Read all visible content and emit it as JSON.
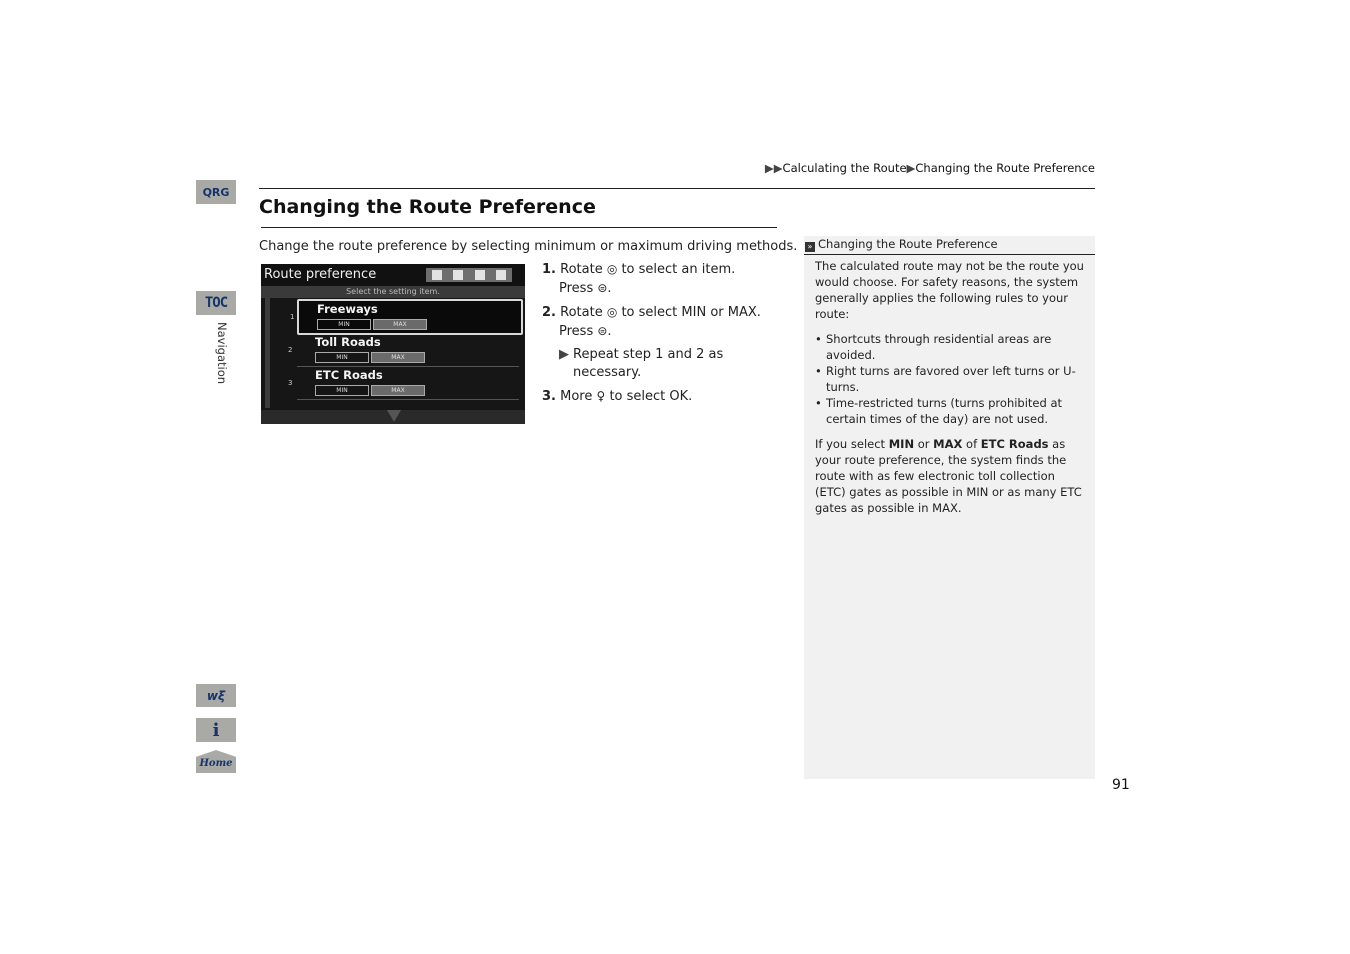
{
  "breadcrumb": {
    "prefix": "▶▶",
    "items": [
      "Calculating the Route",
      "Changing the Route Preference"
    ],
    "separator": "▶"
  },
  "side_tabs": {
    "qrg": "QRG",
    "toc": "TOC",
    "section": "Navigation",
    "voice_icon": "voice-command-icon",
    "info_icon": "info-icon",
    "home": "Home"
  },
  "title": "Changing the Route Preference",
  "intro": "Change the route preference by selecting minimum or maximum driving methods.",
  "screen": {
    "title": "Route preference",
    "subtitle": "Select the setting item.",
    "rows": [
      {
        "num": "1",
        "label": "Freeways",
        "min": "MIN",
        "max": "MAX",
        "selected": true
      },
      {
        "num": "2",
        "label": "Toll Roads",
        "min": "MIN",
        "max": "MAX",
        "selected": false
      },
      {
        "num": "3",
        "label": "ETC Roads",
        "min": "MIN",
        "max": "MAX",
        "selected": false
      }
    ]
  },
  "steps": {
    "s1": {
      "num": "1.",
      "a": "Rotate",
      "b": "to select an item.",
      "press": "Press"
    },
    "s2": {
      "num": "2.",
      "a": "Rotate",
      "b": "to select",
      "min": "MIN",
      "or": "or",
      "max": "MAX",
      "dot": ".",
      "press": "Press"
    },
    "note": "Repeat step 1 and 2 as necessary.",
    "s3": {
      "num": "3.",
      "a": "More",
      "b": "to select",
      "ok": "OK",
      "dot": "."
    }
  },
  "sidebar": {
    "heading": "Changing the Route Preference",
    "p1": "The calculated route may not be the route you would choose. For safety reasons, the system generally applies the following rules to your route:",
    "bullets": [
      "Shortcuts through residential areas are avoided.",
      "Right turns are favored over left turns or U-turns.",
      "Time-restricted turns (turns prohibited at certain times of the day) are not used."
    ],
    "p2": {
      "t1": "If you select ",
      "min": "MIN",
      "t2": " or ",
      "max": "MAX",
      "t3": " of ",
      "etc": "ETC Roads",
      "t4": " as your route preference, the system finds the route with as few electronic toll collection (ETC) gates as possible in MIN or as many ETC gates as possible in MAX."
    }
  },
  "page_number": "91"
}
